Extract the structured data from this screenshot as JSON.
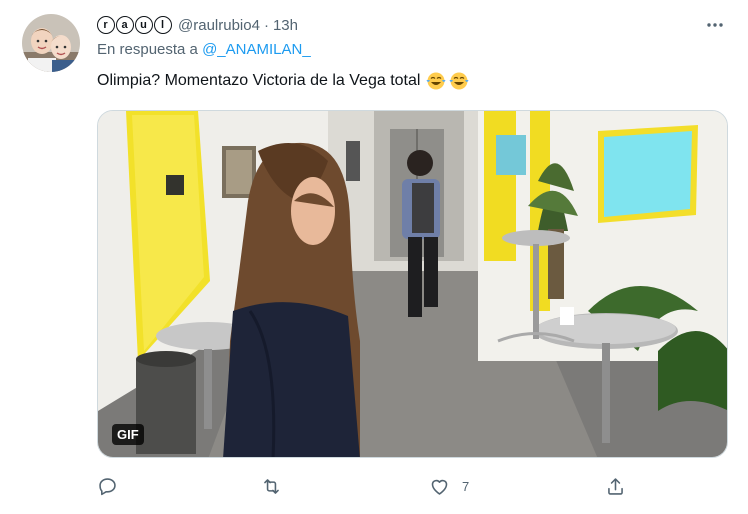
{
  "tweet": {
    "author": {
      "display_name_letters": [
        "r",
        "a",
        "u",
        "l"
      ],
      "handle": "@raulrubio4",
      "separator": "·",
      "timestamp": "13h",
      "avatar_icon": "profile-photo-two-children"
    },
    "reply_to": {
      "prefix": "En respuesta a",
      "mention": "@_ANAMILAN_"
    },
    "text": "Olimpia? Momentazo Victoria de la Vega total",
    "emojis": [
      "face-with-tears-of-joy",
      "face-with-tears-of-joy"
    ],
    "media": {
      "badge": "GIF"
    },
    "actions": {
      "reply": {
        "icon": "reply-icon",
        "count": ""
      },
      "retweet": {
        "icon": "retweet-icon",
        "count": ""
      },
      "like": {
        "icon": "heart-icon",
        "count": "7"
      },
      "share": {
        "icon": "share-icon",
        "count": ""
      }
    },
    "more_icon": "more-options-icon",
    "colors": {
      "accent": "#1d9bf0",
      "text_primary": "#0f1419",
      "text_secondary": "#536471",
      "border": "#cfd9de"
    }
  }
}
